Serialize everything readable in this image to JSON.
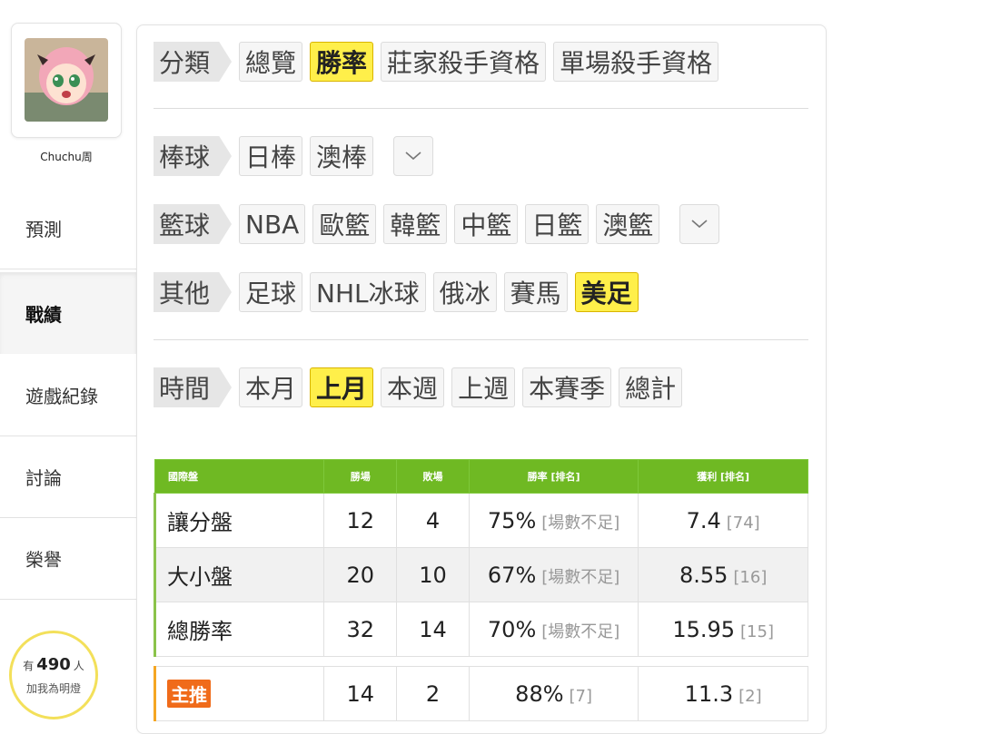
{
  "sidebar": {
    "username": "Chuchu周",
    "nav": [
      "預測",
      "戰績",
      "遊戲紀錄",
      "討論",
      "榮譽"
    ],
    "fans": {
      "prefix": "有",
      "count": "490",
      "suffix": "人",
      "line2": "加我為明燈"
    }
  },
  "filters": {
    "category": {
      "label": "分類",
      "options": [
        "總覽",
        "勝率",
        "莊家殺手資格",
        "單場殺手資格"
      ],
      "selected": "勝率"
    },
    "baseball": {
      "label": "棒球",
      "options": [
        "日棒",
        "澳棒"
      ]
    },
    "basketball": {
      "label": "籃球",
      "options": [
        "NBA",
        "歐籃",
        "韓籃",
        "中籃",
        "日籃",
        "澳籃"
      ]
    },
    "other": {
      "label": "其他",
      "options": [
        "足球",
        "NHL冰球",
        "俄冰",
        "賽馬",
        "美足"
      ],
      "selected": "美足"
    },
    "time": {
      "label": "時間",
      "options": [
        "本月",
        "上月",
        "本週",
        "上週",
        "本賽季",
        "總計"
      ],
      "selected": "上月"
    }
  },
  "table": {
    "headers": [
      "國際盤",
      "勝場",
      "敗場",
      "勝率 [排名]",
      "獲利 [排名]"
    ],
    "rows": [
      {
        "label": "讓分盤",
        "win": "12",
        "lose": "4",
        "rate": "75%",
        "rate_rank": "[場數不足]",
        "profit": "7.4",
        "profit_rank": "[74]"
      },
      {
        "label": "大小盤",
        "win": "20",
        "lose": "10",
        "rate": "67%",
        "rate_rank": "[場數不足]",
        "profit": "8.55",
        "profit_rank": "[16]"
      },
      {
        "label": "總勝率",
        "win": "32",
        "lose": "14",
        "rate": "70%",
        "rate_rank": "[場數不足]",
        "profit": "15.95",
        "profit_rank": "[15]"
      }
    ],
    "main": {
      "label": "主推",
      "win": "14",
      "lose": "2",
      "rate": "88%",
      "rate_rank": "[7]",
      "profit": "11.3",
      "profit_rank": "[2]"
    }
  },
  "icons": {
    "more": "chevron-down-icon"
  },
  "colors": {
    "accent": "#ffef4a",
    "table_header": "#6fb923",
    "main_tag": "#f06b1a",
    "fan_ring": "#f3e05a"
  }
}
